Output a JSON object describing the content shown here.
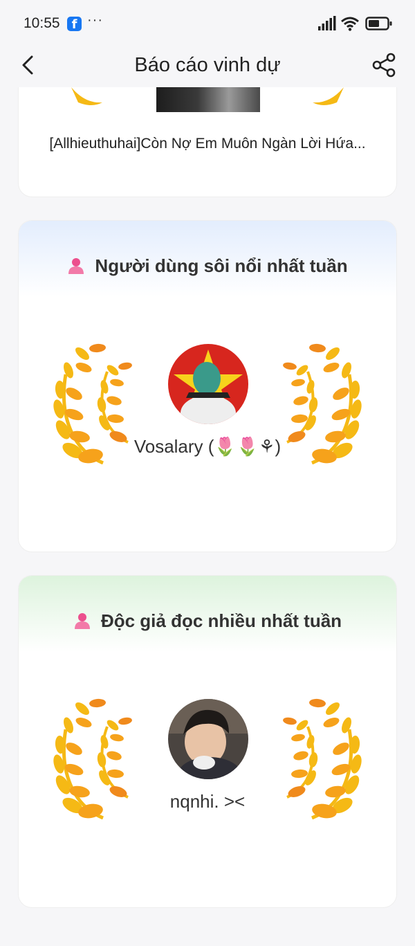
{
  "status_bar": {
    "time": "10:55",
    "more": "···"
  },
  "nav": {
    "title": "Báo cáo vinh dự"
  },
  "top_card": {
    "book_title": "[Allhieuthuhai]Còn Nợ Em Muôn Ngàn Lời Hứa..."
  },
  "user_card": {
    "heading": "Người dùng sôi nổi nhất tuần",
    "username": "Vosalary (🌷🌷⚘)"
  },
  "reader_card": {
    "heading": "Độc giả đọc nhiều nhất tuần",
    "username": "nqnhi. ><"
  },
  "colors": {
    "accent": "#f2a10f",
    "person_icon": "#ec4f8d",
    "fb_blue": "#1877f2"
  }
}
